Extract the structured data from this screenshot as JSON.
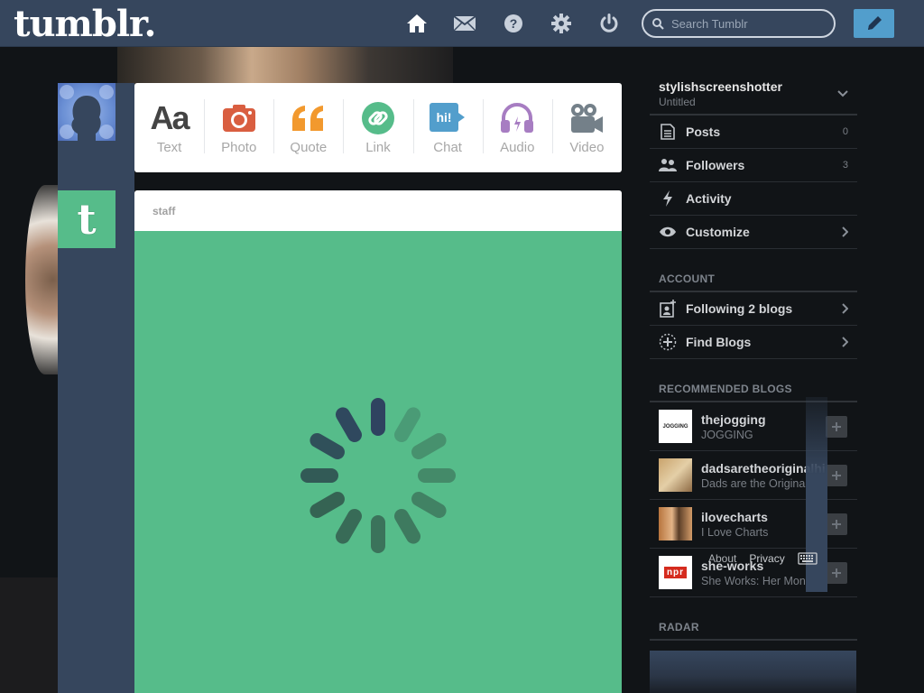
{
  "header": {
    "logo": "tumblr.",
    "nav_icons": [
      "home-icon",
      "mail-icon",
      "help-icon",
      "gear-icon",
      "power-icon"
    ],
    "search_placeholder": "Search Tumblr",
    "compose_icon": "pencil-icon"
  },
  "post_types": [
    {
      "label": "Text",
      "icon": "text-aa-icon",
      "color": "#444444"
    },
    {
      "label": "Photo",
      "icon": "camera-icon",
      "color": "#d95e40"
    },
    {
      "label": "Quote",
      "icon": "quote-icon",
      "color": "#f2992e"
    },
    {
      "label": "Link",
      "icon": "link-icon",
      "color": "#56bc8a"
    },
    {
      "label": "Chat",
      "icon": "chat-icon",
      "color": "#529ecc",
      "glyph": "hi!"
    },
    {
      "label": "Audio",
      "icon": "headphones-icon",
      "color": "#a77dc2"
    },
    {
      "label": "Video",
      "icon": "video-camera-icon",
      "color": "#748089"
    }
  ],
  "staff_post": {
    "blog": "staff",
    "avatar_letter": "t",
    "body_color": "#56bc8a"
  },
  "sidebar": {
    "blog_name": "stylishscreenshotter",
    "blog_title": "Untitled",
    "items": [
      {
        "label": "Posts",
        "icon": "posts-icon",
        "count": "0"
      },
      {
        "label": "Followers",
        "icon": "followers-icon",
        "count": "3"
      },
      {
        "label": "Activity",
        "icon": "lightning-icon",
        "count": ""
      },
      {
        "label": "Customize",
        "icon": "eye-icon",
        "count": ""
      }
    ],
    "account_title": "ACCOUNT",
    "account_items": [
      {
        "label": "Following 2 blogs",
        "icon": "following-icon"
      },
      {
        "label": "Find Blogs",
        "icon": "find-blogs-icon"
      }
    ],
    "recommended_title": "RECOMMENDED BLOGS",
    "recommended": [
      {
        "name": "thejogging",
        "desc": "JOGGING",
        "avatar": "JOGGING"
      },
      {
        "name": "dadsaretheoriginalhipsters",
        "desc": "Dads are the Original Hipsters",
        "avatar": ""
      },
      {
        "name": "ilovecharts",
        "desc": "I Love Charts",
        "avatar": ""
      },
      {
        "name": "she-works",
        "desc": "She Works: Her Money",
        "avatar": "npr"
      }
    ],
    "footer_links": [
      "About",
      "Privacy"
    ],
    "radar_title": "RADAR"
  }
}
